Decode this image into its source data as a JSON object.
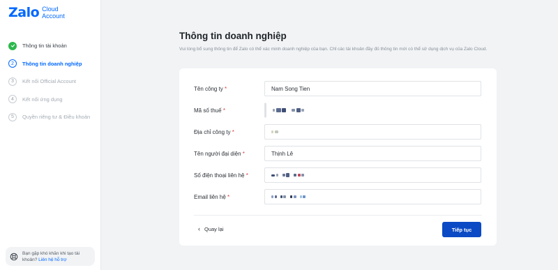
{
  "logo": {
    "word": "Zalo",
    "sub_line1": "Cloud",
    "sub_line2": "Account"
  },
  "steps": [
    {
      "num": "",
      "label": "Thông tin tài khoản",
      "state": "done"
    },
    {
      "num": "2",
      "label": "Thông tin doanh nghiệp",
      "state": "active"
    },
    {
      "num": "3",
      "label": "Kết nối Official Account",
      "state": "pending"
    },
    {
      "num": "4",
      "label": "Kết nối ứng dụng",
      "state": "pending"
    },
    {
      "num": "5",
      "label": "Quyền riêng tư & Điều khoản",
      "state": "pending"
    }
  ],
  "help": {
    "text_line1": "Bạn gặp khó khăn khi tạo tài",
    "text_prefix": "khoản?",
    "link": "Liên hệ hỗ trợ"
  },
  "page": {
    "title": "Thông tin doanh nghiệp",
    "description": "Vui lòng bổ sung thông tin để Zalo có thể xác minh doanh nghiệp của bạn. Chỉ các tài khoản đầy đủ thông tin mới có thể sử dụng dịch vụ của Zalo Cloud."
  },
  "form": {
    "required_mark": "*",
    "fields": [
      {
        "label": "Tên công ty",
        "value": "Nam Song Tien"
      },
      {
        "label": "Mã số thuế",
        "value": ""
      },
      {
        "label": "Địa chỉ công ty",
        "value": ""
      },
      {
        "label": "Tên người đại diện",
        "value": "Thịnh Lê"
      },
      {
        "label": "Số điện thoại liên hệ",
        "value": ""
      },
      {
        "label": "Email liên hệ",
        "value": ""
      }
    ]
  },
  "actions": {
    "back_label": "Quay lại",
    "next_label": "Tiếp tục"
  },
  "colors": {
    "brand": "#0068ff",
    "primary_button": "#0b4ac4",
    "success": "#2db84d",
    "required": "#e03c3c"
  }
}
